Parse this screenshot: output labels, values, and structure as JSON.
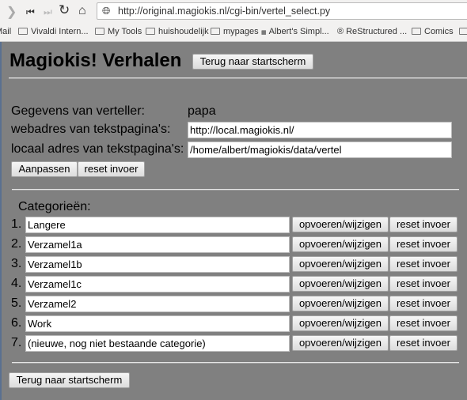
{
  "browser": {
    "url": "http://original.magiokis.nl/cgi-bin/vertel_select.py",
    "bookmarks": [
      "Mail",
      "Vivaldi Intern...",
      "My Tools",
      "huishoudelijk",
      "mypages",
      "Albert's Simpl...",
      "ReStructured ...",
      "Comics"
    ]
  },
  "header": {
    "title": "Magiokis! Verhalen",
    "back_button": "Terug naar startscherm"
  },
  "verteller": {
    "label": "Gegevens van verteller:",
    "name": "papa",
    "web_label": "webadres van tekstpagina's:",
    "web_value": "http://local.magiokis.nl/",
    "local_label": "locaal adres van tekstpagina's:",
    "local_value": "/home/albert/magiokis/data/vertel",
    "submit": "Aanpassen",
    "reset": "reset invoer"
  },
  "categories": {
    "heading": "Categorieën:",
    "submit": "opvoeren/wijzigen",
    "reset": "reset invoer",
    "items": [
      {
        "num": "1.",
        "value": "Langere"
      },
      {
        "num": "2.",
        "value": "Verzamel1a"
      },
      {
        "num": "3.",
        "value": "Verzamel1b"
      },
      {
        "num": "4.",
        "value": "Verzamel1c"
      },
      {
        "num": "5.",
        "value": "Verzamel2"
      },
      {
        "num": "6.",
        "value": "Work"
      },
      {
        "num": "7.",
        "value": "(nieuwe, nog niet bestaande categorie)"
      }
    ]
  },
  "footer": {
    "back_button": "Terug naar startscherm"
  }
}
